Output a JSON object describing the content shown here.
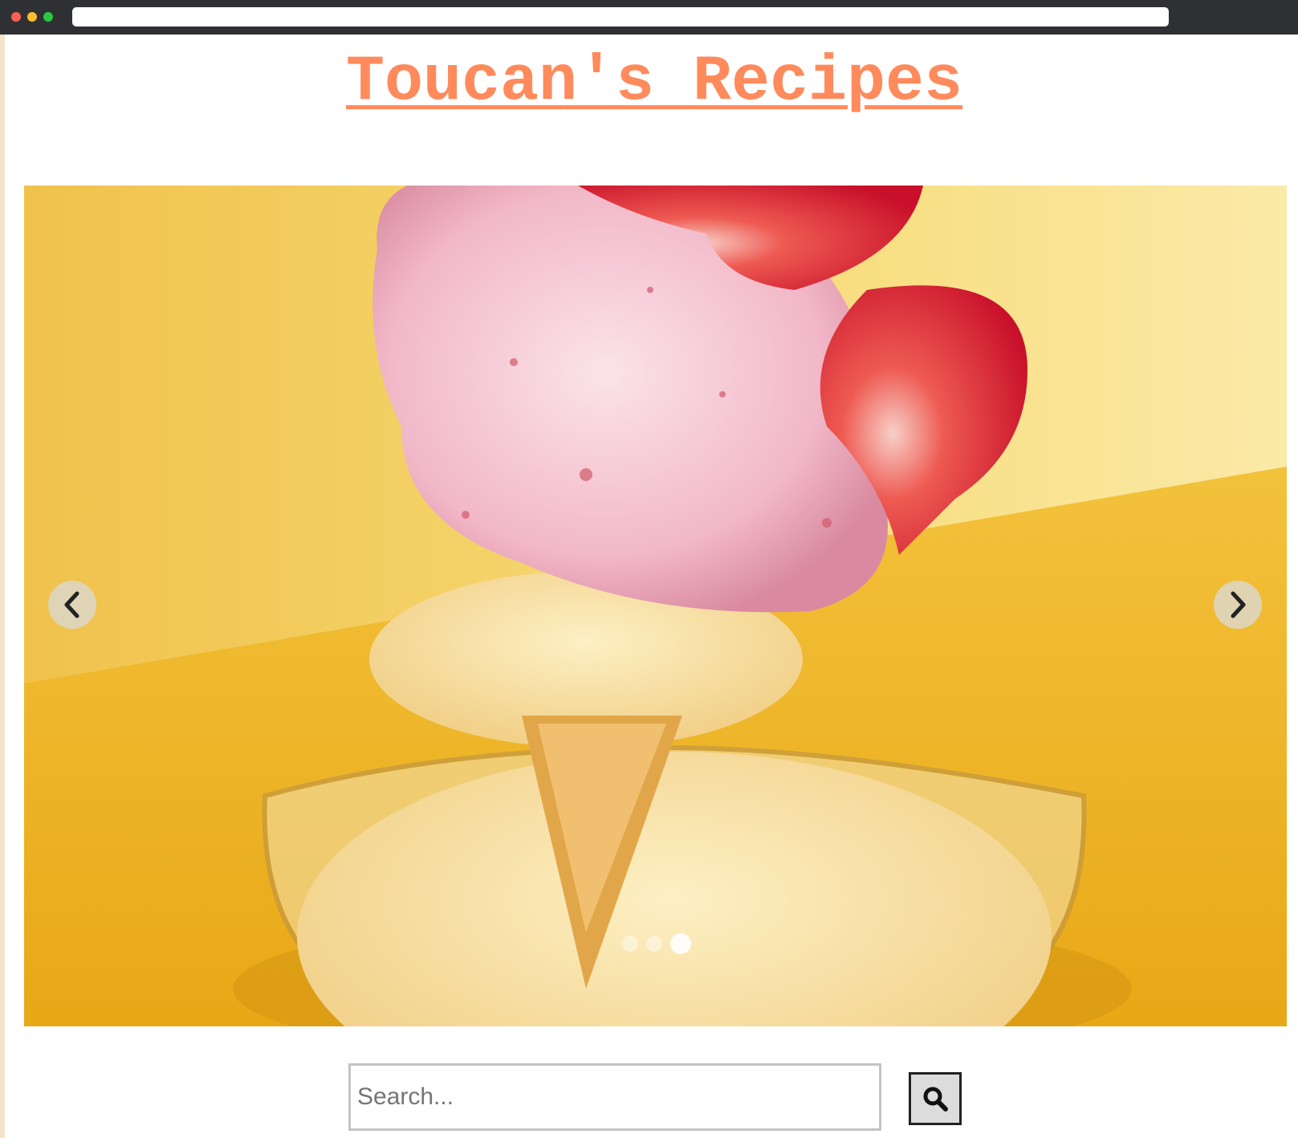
{
  "header": {
    "title": "Toucan's Recipes"
  },
  "carousel": {
    "image_subject": "strawberry and vanilla ice cream sundae in a glass bowl",
    "prev_icon": "chevron-left-icon",
    "next_icon": "chevron-right-icon",
    "slide_count": 3,
    "active_slide": 3
  },
  "search": {
    "placeholder": "Search...",
    "value": "",
    "button_icon": "search-icon"
  },
  "colors": {
    "title": "#ff8a5c",
    "browser_chrome": "#2f3033",
    "carousel_background": "#f1c24a"
  }
}
